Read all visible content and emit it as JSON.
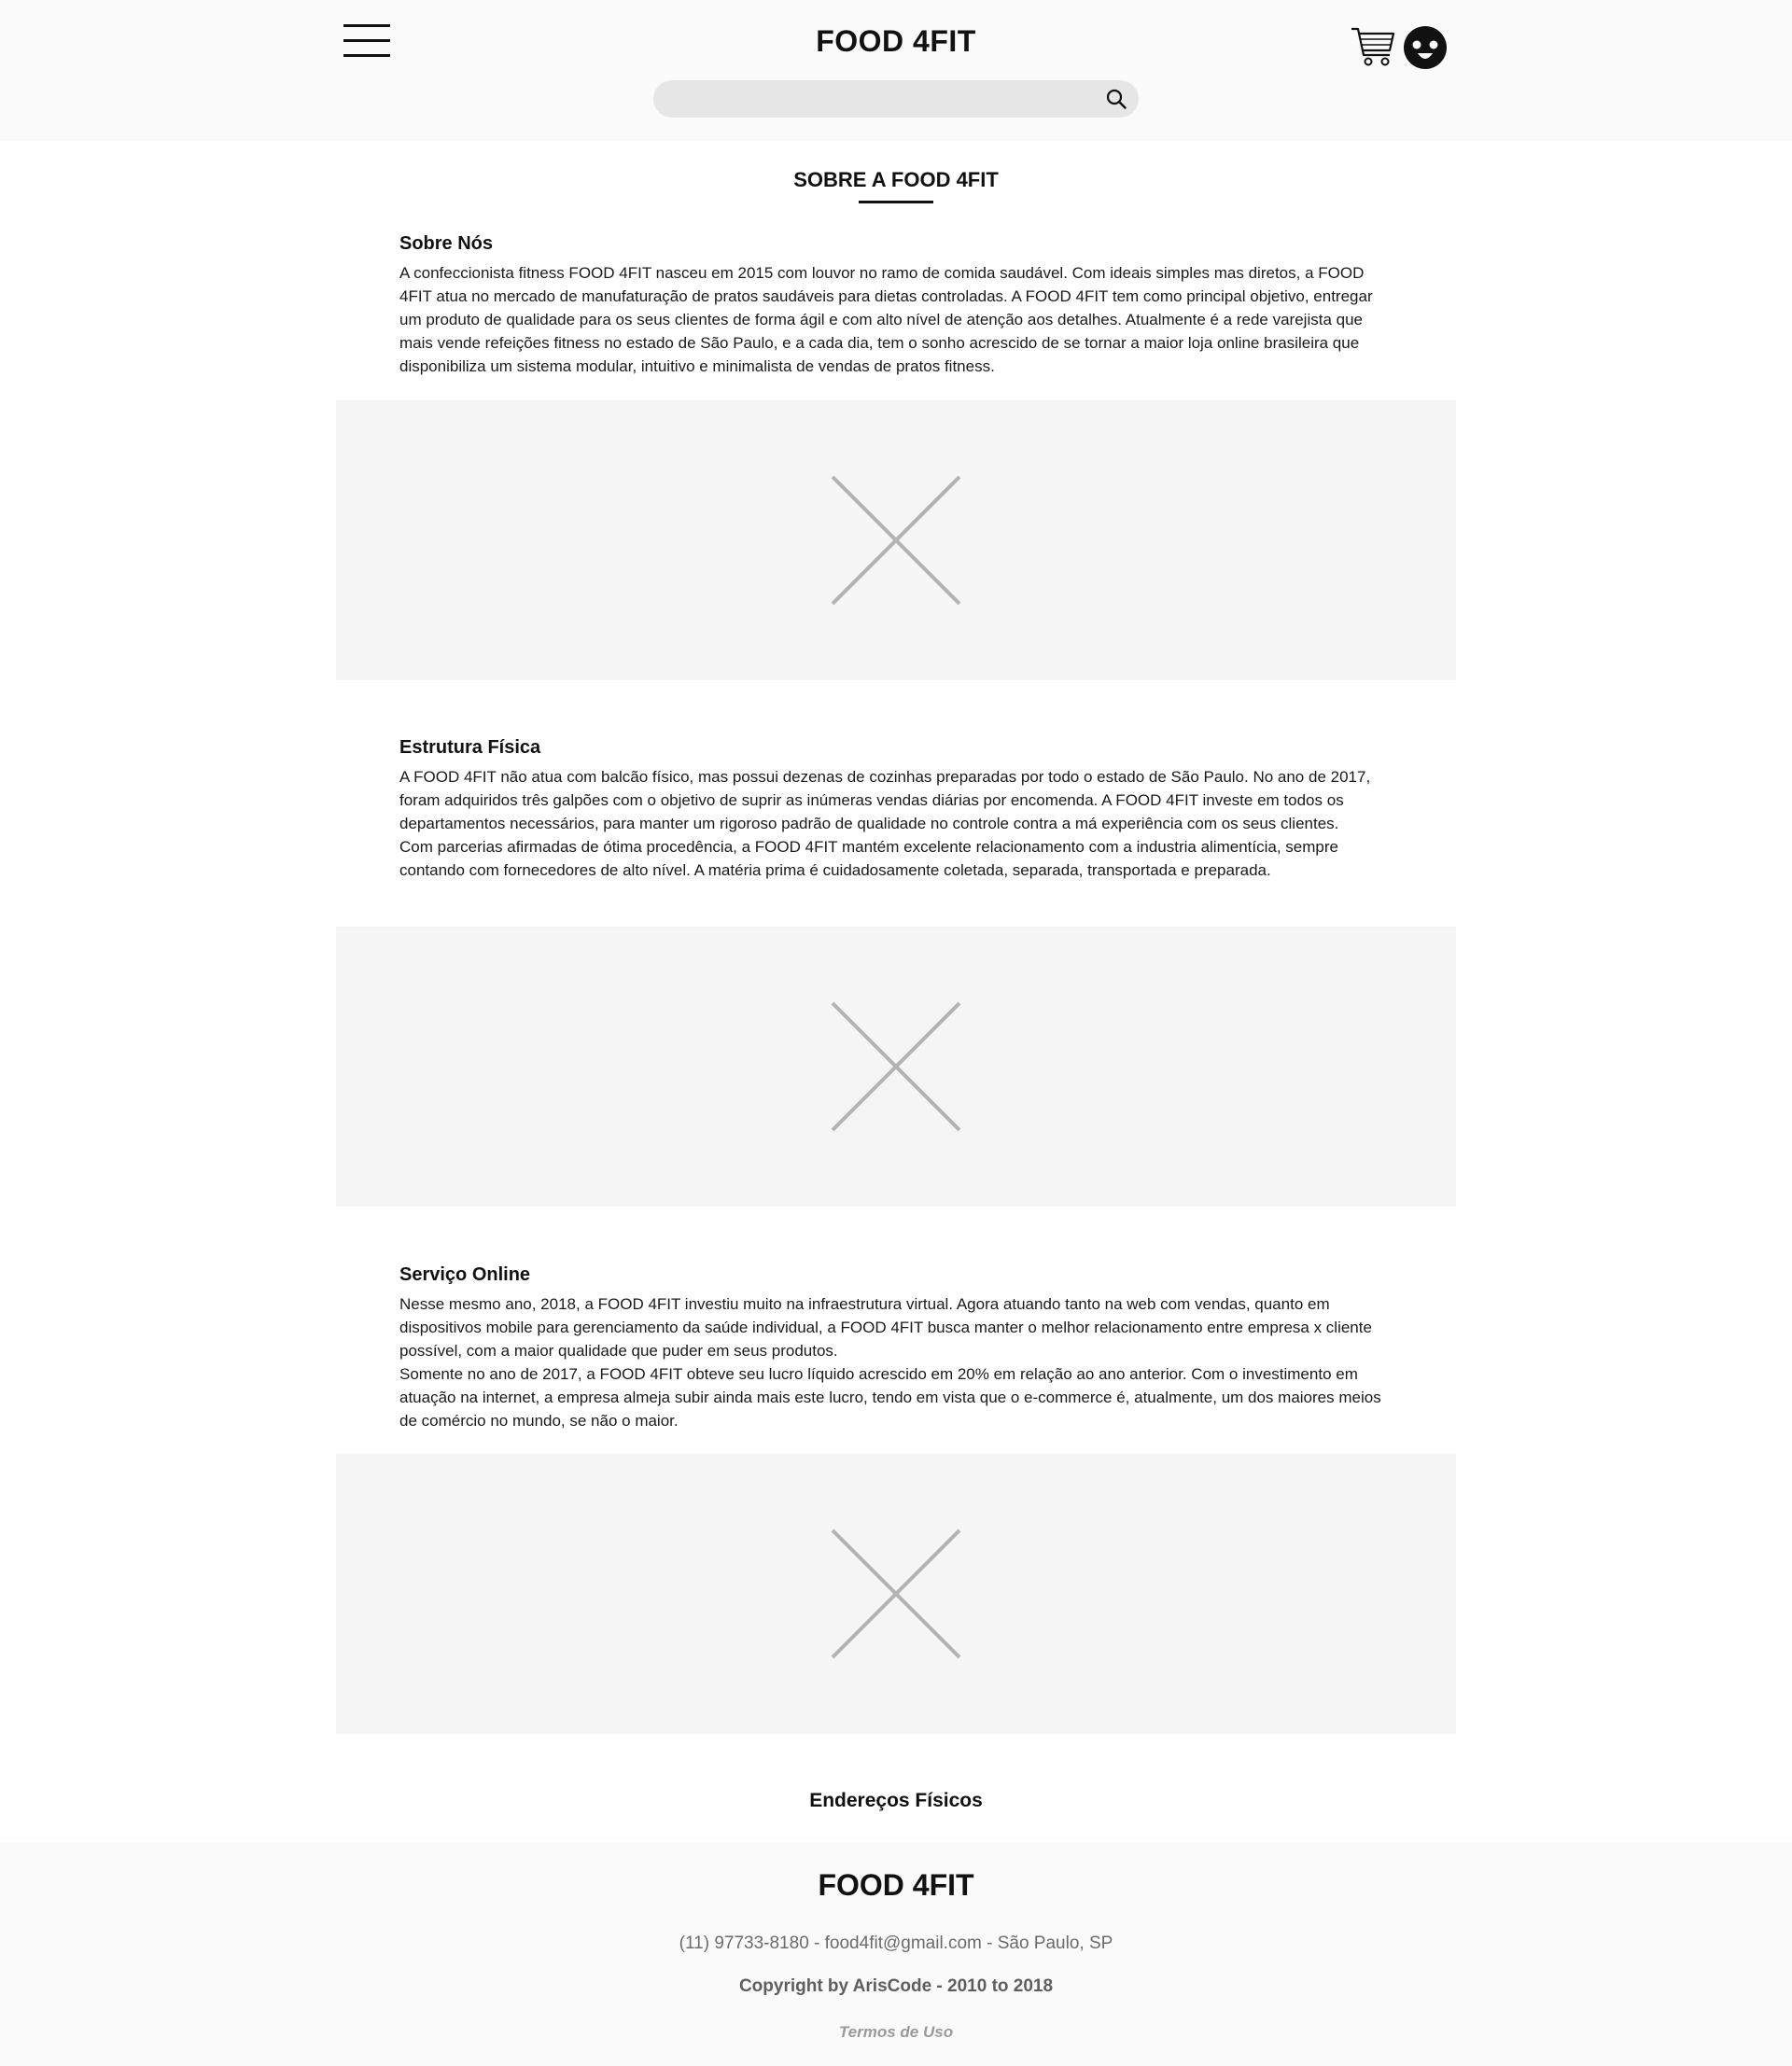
{
  "header": {
    "brand": "FOOD 4FIT",
    "search": {
      "value": "",
      "placeholder": ""
    },
    "icons": {
      "menu": "hamburger-menu-icon",
      "search": "search-icon",
      "cart": "shopping-cart-icon",
      "user": "user-avatar-icon"
    }
  },
  "main": {
    "page_title": "SOBRE A FOOD 4FIT",
    "sections": [
      {
        "title": "Sobre Nós",
        "paragraphs": [
          "A confeccionista fitness FOOD 4FIT nasceu em 2015 com louvor no ramo de comida saudável. Com ideais simples mas diretos, a FOOD 4FIT atua no mercado de manufaturação de pratos saudáveis para dietas controladas. A FOOD 4FIT tem como principal objetivo, entregar um produto de qualidade para os seus clientes de forma ágil e com alto nível de atenção aos detalhes. Atualmente é a rede varejista que mais vende refeições fitness no estado de São Paulo, e a cada dia, tem o sonho acrescido de se tornar a maior loja online brasileira que disponibiliza um sistema modular, intuitivo e minimalista de vendas de pratos fitness."
        ]
      },
      {
        "title": "Estrutura Física",
        "paragraphs": [
          "A FOOD 4FIT não atua com balcão físico, mas possui dezenas de cozinhas preparadas por todo o estado de São Paulo. No ano de 2017, foram adquiridos três galpões com o objetivo de suprir as inúmeras vendas diárias por encomenda. A FOOD 4FIT investe em todos os departamentos necessários, para manter um rigoroso padrão de qualidade no controle contra a má experiência com os seus clientes.",
          "Com parcerias afirmadas de ótima procedência, a FOOD 4FIT mantém excelente relacionamento com a industria alimentícia, sempre contando com fornecedores de alto nível. A matéria prima é cuidadosamente coletada, separada, transportada e preparada."
        ]
      },
      {
        "title": "Serviço Online",
        "paragraphs": [
          "Nesse mesmo ano, 2018, a FOOD 4FIT investiu muito na infraestrutura virtual. Agora atuando tanto na web com vendas, quanto em dispositivos mobile para gerenciamento da saúde individual, a FOOD 4FIT busca manter o melhor relacionamento entre empresa x cliente possível, com a maior qualidade que puder em seus produtos.",
          "Somente no ano de 2017, a FOOD 4FIT obteve seu lucro líquido acrescido em 20% em relação ao ano anterior. Com o investimento em atuação na  internet, a empresa almeja subir ainda mais este lucro, tendo em vista que o e-commerce é, atualmente, um dos maiores meios de comércio no mundo, se não o maior."
        ]
      }
    ],
    "image_placeholder_icon": "image-placeholder-icon",
    "addresses_link": "Endereços Físicos"
  },
  "footer": {
    "brand": "FOOD 4FIT",
    "contact": "(11) 97733-8180 - food4fit@gmail.com - São Paulo, SP",
    "copyright": "Copyright by ArisCode - 2010 to 2018",
    "terms": "Termos de Uso"
  },
  "colors": {
    "header_bg": "#fafafa",
    "placeholder_bg": "#f5f5f5",
    "search_bg": "#e6e6e6",
    "text": "#111111",
    "footer_muted": "#6b6b6b"
  }
}
